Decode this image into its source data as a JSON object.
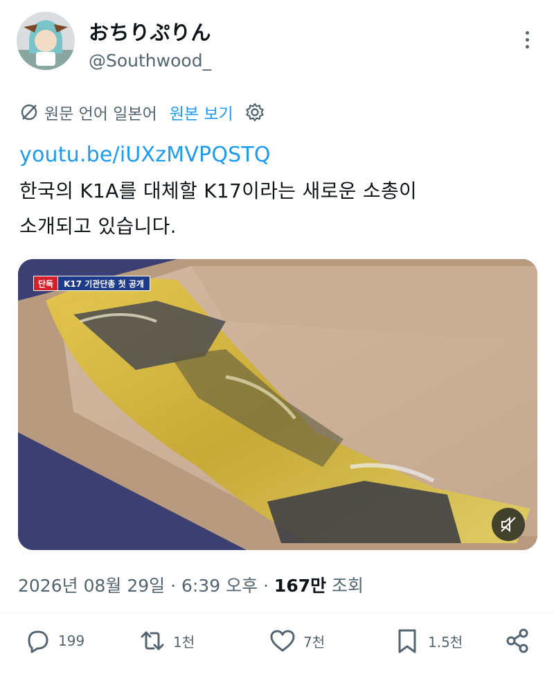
{
  "author": {
    "display_name": "おちりぷりん",
    "handle": "@Southwood_"
  },
  "translation": {
    "source_language_text": "원문 언어 일본어",
    "show_original_label": "원본 보기"
  },
  "tweet": {
    "link": "youtu.be/iUXzMVPQSTQ",
    "text_line1": "한국의 K1A를 대체할 K17이라는 새로운 소총이",
    "text_line2": "소개되고 있습니다."
  },
  "media": {
    "badge_red": "단독",
    "badge_blue": "K17 기관단총 첫 공개"
  },
  "meta": {
    "datetime": "2026년 08월 29일 · 6:39 오후 · ",
    "views_count": "167만",
    "views_label": " 조회"
  },
  "actions": {
    "replies": "199",
    "reposts": "1천",
    "likes": "7천",
    "bookmarks": "1.5천"
  },
  "colors": {
    "accent": "#1d9bf0",
    "secondary_text": "#536471",
    "primary_text": "#0f1419"
  },
  "icons": [
    "more-vertical-icon",
    "globe-strike-icon",
    "gear-icon",
    "mute-icon",
    "reply-icon",
    "repost-icon",
    "like-icon",
    "bookmark-icon",
    "share-icon"
  ]
}
